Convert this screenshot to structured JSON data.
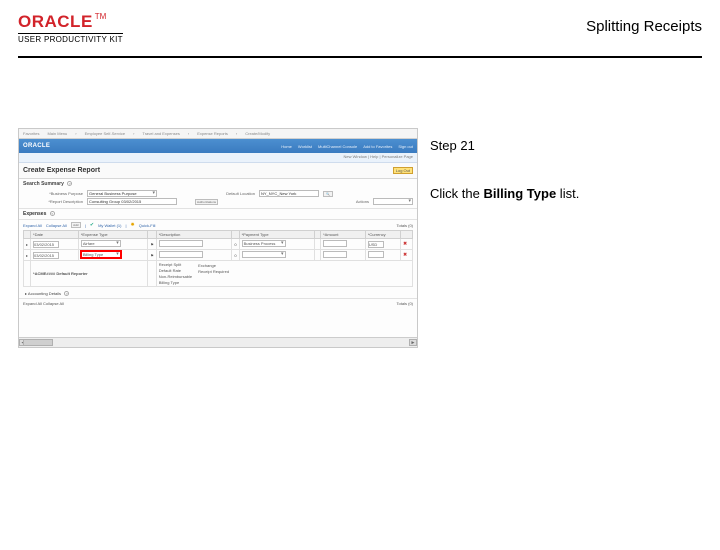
{
  "header": {
    "brand_main": "ORACLE",
    "brand_tm": "TM",
    "brand_sub": "USER PRODUCTIVITY KIT",
    "title": "Splitting Receipts"
  },
  "right": {
    "step": "Step 21",
    "instr_pre": "Click the ",
    "instr_bold": "Billing Type",
    "instr_post": " list."
  },
  "shot": {
    "tabs": [
      "Favorites",
      "Main Menu",
      "Employee Self-Service",
      "Travel and Expenses",
      "Expense Reports",
      "Create/Modify"
    ],
    "topbar_logo": "ORACLE",
    "topbar_menu": [
      "Home",
      "Worklist",
      "MultiChannel Console",
      "Add to Favorites",
      "Sign out"
    ],
    "subbar": "New Window | Help | Personalize Page",
    "report_title": "Create Expense Report",
    "logout": "Log Out",
    "search": {
      "title": "Search Summary",
      "help": "?",
      "bo_lbl": "*Business Purpose",
      "bo_val": "General Business Purpose",
      "rd_lbl": "*Report Description",
      "rd_val": "Consulting Group 03/02/2015",
      "dl_lbl": "Default Location",
      "dl_val": "NY_NYC_New York",
      "auth_btn": "Authorizations",
      "actions_lbl": "Actions",
      "actions_dd": ""
    },
    "expenses": {
      "title": "Expenses",
      "help": "?",
      "toolbar": [
        "Expand All",
        "Collapse All",
        "Add",
        "|",
        "My Wallet (1)",
        "|",
        "Quick-Fill"
      ],
      "total_lbl": "Totals (0)",
      "cols": [
        "",
        "*Date",
        "*Expense Type",
        "",
        "*Description",
        "",
        "*Payment Type",
        "",
        "*Amount",
        "*Currency",
        ""
      ],
      "rows": [
        {
          "date": "03/02/2015",
          "type": "Airfare",
          "desc": "",
          "pay": "Business Process",
          "amt": "",
          "cur": "USD"
        },
        {
          "date": "03/02/2015",
          "type": "",
          "desc": "Billing Type",
          "pay": "",
          "amt": "",
          "cur": ""
        }
      ],
      "sidepanel": [
        "Receipt Split",
        "Default Rate",
        "Non-Reimbursable",
        "Billing Type"
      ],
      "sidecol2": [
        "",
        "Exchange",
        "Receipt Required",
        ""
      ]
    },
    "acc_det": "Accounting Details",
    "footer_left": "Expand All   Collapse All",
    "footer_right": "Totals (0)",
    "scroll_left": "◄",
    "scroll_right": "►"
  }
}
